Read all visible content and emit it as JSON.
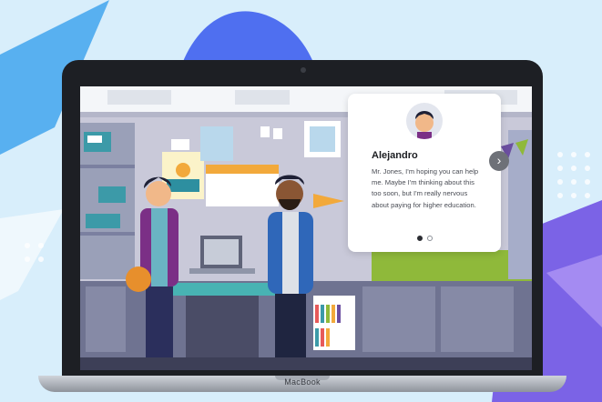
{
  "dialog": {
    "speaker": "Alejandro",
    "message": "Mr. Jones, I'm hoping you can help me. Maybe I'm thinking about this too soon, but I'm really nervous about paying for higher education.",
    "pages_total": 2,
    "page_current": 1,
    "next_icon": "chevron-right-icon"
  },
  "device": {
    "brand_label": "MacBook"
  },
  "scene": {
    "accent_color": "#8fb93a",
    "bg_color": "#d8eefb"
  }
}
